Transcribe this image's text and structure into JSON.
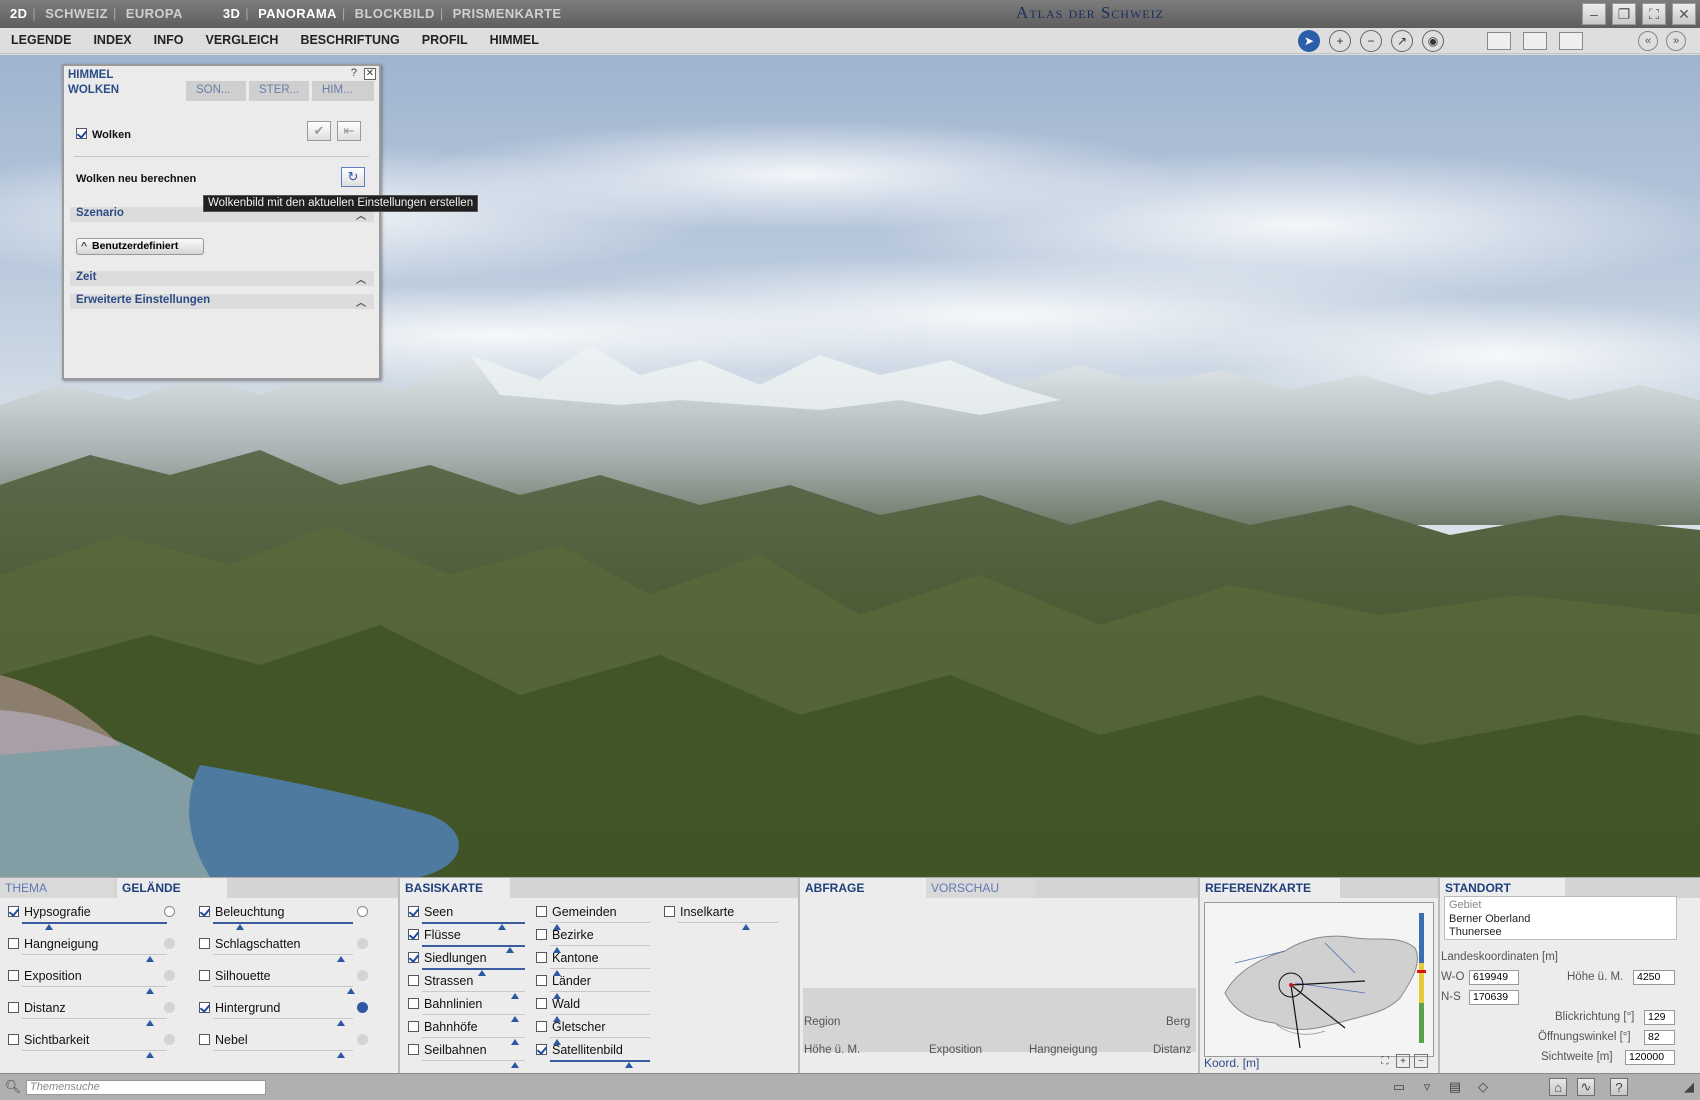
{
  "titlebar": {
    "modes": [
      "2D",
      "SCHWEIZ",
      "EUROPA",
      "3D",
      "PANORAMA",
      "BLOCKBILD",
      "PRISMENKARTE"
    ],
    "app_title": "Atlas der Schweiz"
  },
  "menubar": {
    "items": [
      "LEGENDE",
      "INDEX",
      "INFO",
      "VERGLEICH",
      "BESCHRIFTUNG",
      "PROFIL",
      "HIMMEL"
    ]
  },
  "himmel_panel": {
    "title": "HIMMEL",
    "help": "?",
    "tabs": [
      "WOLKEN",
      "SON...",
      "STER...",
      "HIM..."
    ],
    "wolken_label": "Wolken",
    "recalc_label": "Wolken neu berechnen",
    "tooltip": "Wolkenbild mit den aktuellen Einstellungen erstellen",
    "section_szenario": "Szenario",
    "preset_button": "Benutzerdefiniert",
    "section_zeit": "Zeit",
    "section_erweitert": "Erweiterte Einstellungen"
  },
  "bottom": {
    "thema_tabs": [
      "THEMA",
      "GELÄNDE"
    ],
    "gelaende_left": [
      {
        "label": "Hypsografie",
        "checked": true
      },
      {
        "label": "Hangneigung",
        "checked": false
      },
      {
        "label": "Exposition",
        "checked": false
      },
      {
        "label": "Distanz",
        "checked": false
      },
      {
        "label": "Sichtbarkeit",
        "checked": false
      }
    ],
    "gelaende_right": [
      {
        "label": "Beleuchtung",
        "checked": true
      },
      {
        "label": "Schlagschatten",
        "checked": false
      },
      {
        "label": "Silhouette",
        "checked": false
      },
      {
        "label": "Hintergrund",
        "checked": true
      },
      {
        "label": "Nebel",
        "checked": false
      }
    ],
    "basiskarte_title": "BASISKARTE",
    "basiskarte_col1": [
      {
        "label": "Seen",
        "checked": true
      },
      {
        "label": "Flüsse",
        "checked": true
      },
      {
        "label": "Siedlungen",
        "checked": true
      },
      {
        "label": "Strassen",
        "checked": false
      },
      {
        "label": "Bahnlinien",
        "checked": false
      },
      {
        "label": "Bahnhöfe",
        "checked": false
      },
      {
        "label": "Seilbahnen",
        "checked": false
      }
    ],
    "basiskarte_col2": [
      {
        "label": "Gemeinden",
        "checked": false
      },
      {
        "label": "Bezirke",
        "checked": false
      },
      {
        "label": "Kantone",
        "checked": false
      },
      {
        "label": "Länder",
        "checked": false
      },
      {
        "label": "Wald",
        "checked": false
      },
      {
        "label": "Gletscher",
        "checked": false
      },
      {
        "label": "Satellitenbild",
        "checked": true
      }
    ],
    "basiskarte_col3": [
      {
        "label": "Inselkarte",
        "checked": false
      }
    ],
    "abfrage_tabs": [
      "ABFRAGE",
      "VORSCHAU"
    ],
    "abfrage_labels": {
      "region": "Region",
      "berg": "Berg",
      "hoehe": "Höhe ü. M.",
      "exposition": "Exposition",
      "hangneigung": "Hangneigung",
      "distanz": "Distanz"
    },
    "referenz_title": "REFERENZKARTE",
    "referenz_koord": "Koord. [m]",
    "standort_title": "STANDORT",
    "standort_info": {
      "label": "Gebiet",
      "line1": "Berner Oberland",
      "line2": "Thunersee"
    },
    "landeskoordinaten_label": "Landeskoordinaten [m]",
    "wo_label": "W-O",
    "wo_value": "619949",
    "ns_label": "N-S",
    "ns_value": "170639",
    "hoehe_label": "Höhe ü. M.",
    "hoehe_value": "4250",
    "blick_label": "Blickrichtung [°]",
    "blick_value": "129",
    "oeffnung_label": "Öffnungswinkel [°]",
    "oeffnung_value": "82",
    "sichtweite_label": "Sichtweite [m]",
    "sichtweite_value": "120000"
  },
  "statusbar": {
    "search_placeholder": "Themensuche"
  }
}
